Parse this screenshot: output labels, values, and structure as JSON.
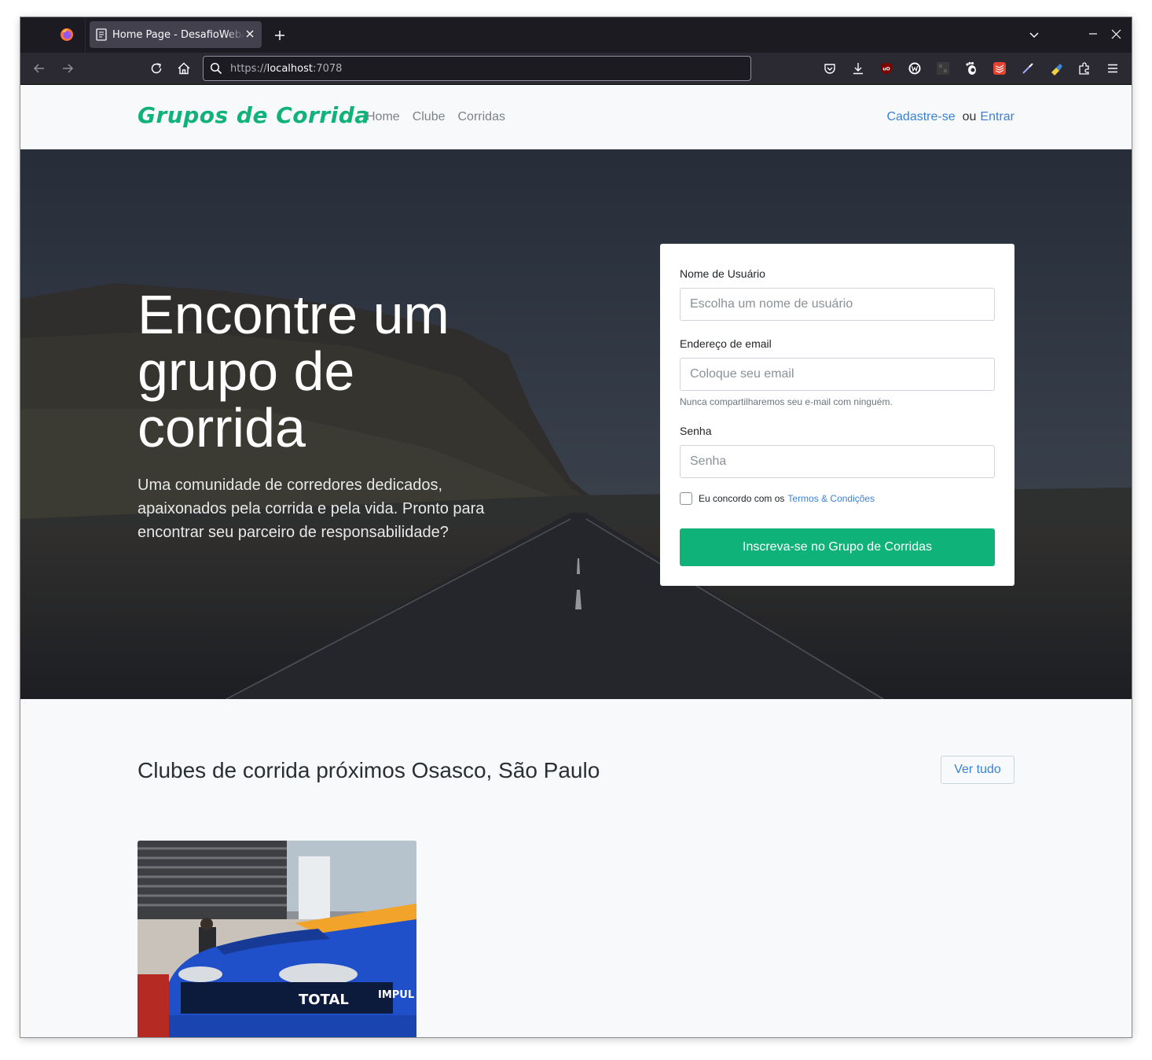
{
  "browser": {
    "tab_title": "Home Page - DesafioWebApp",
    "url_scheme": "https://",
    "url_host": "localhost",
    "url_port": ":7078"
  },
  "header": {
    "brand": "Grupos de Corrida",
    "nav": [
      "Home",
      "Clube",
      "Corridas"
    ],
    "signup_link": "Cadastre-se",
    "or_text": "ou",
    "login_link": "Entrar"
  },
  "hero": {
    "title": "Encontre um grupo de corrida",
    "subtitle": "Uma comunidade de corredores dedicados, apaixonados pela corrida e pela vida. Pronto para encontrar seu parceiro de responsabilidade?"
  },
  "form": {
    "username_label": "Nome de Usuário",
    "username_placeholder": "Escolha um nome de usuário",
    "email_label": "Endereço de email",
    "email_placeholder": "Coloque seu email",
    "email_help": "Nunca compartilharemos seu e-mail com ninguém.",
    "password_label": "Senha",
    "password_placeholder": "Senha",
    "terms_text": "Eu concordo com os",
    "terms_link": "Termos & Condições",
    "submit_label": "Inscreva-se no Grupo de Corridas"
  },
  "clubs": {
    "title": "Clubes de corrida próximos Osasco, São Paulo",
    "see_all": "Ver tudo",
    "car_text_1": "TOTAL",
    "car_text_2": "IMPUL"
  },
  "colors": {
    "brand_green": "#0fb37a",
    "link_blue": "#3b82d6"
  }
}
